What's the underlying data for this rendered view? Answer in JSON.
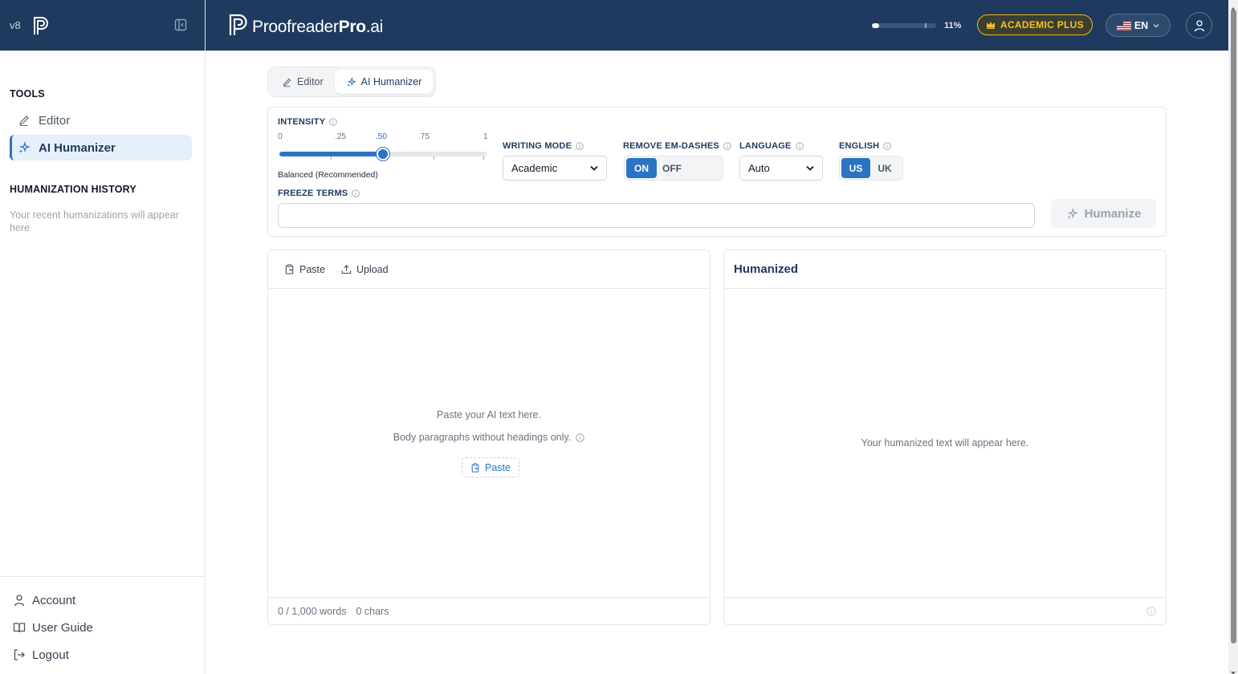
{
  "app": {
    "version": "v8",
    "brand_main": "Proofreader",
    "brand_bold": "Pro",
    "brand_suffix": ".ai",
    "colors": {
      "navy": "#1e3a5f",
      "accent": "#2c73c4",
      "gold": "#f8c029"
    }
  },
  "header": {
    "usage_percent_label": "11%",
    "usage_fraction": 0.11,
    "plan_label": "ACADEMIC PLUS",
    "plan_icon": "crown-icon",
    "language_label": "EN",
    "language_flag": "us-flag-icon",
    "user_icon": "user-icon"
  },
  "sidebar": {
    "tools_title": "TOOLS",
    "tools": [
      {
        "label": "Editor",
        "icon": "pencil-icon",
        "active": false
      },
      {
        "label": "AI Humanizer",
        "icon": "sparkle-icon",
        "active": true
      }
    ],
    "history_title": "HUMANIZATION HISTORY",
    "history_empty": "Your recent humanizations will appear here",
    "bottom": [
      {
        "label": "Account",
        "icon": "user-icon"
      },
      {
        "label": "User Guide",
        "icon": "book-icon"
      },
      {
        "label": "Logout",
        "icon": "logout-icon"
      }
    ]
  },
  "mode_tabs": [
    {
      "label": "Editor",
      "icon": "pencil-icon",
      "active": false
    },
    {
      "label": "AI Humanizer",
      "icon": "sparkle-icon",
      "active": true
    }
  ],
  "settings": {
    "intensity": {
      "label": "INTENSITY",
      "ticks": [
        "0",
        ".25",
        ".50",
        ".75",
        "1"
      ],
      "value": 0.5,
      "description": "Balanced (Recommended)"
    },
    "writing_mode": {
      "label": "WRITING MODE",
      "value": "Academic"
    },
    "remove_em_dashes": {
      "label": "REMOVE EM-DASHES",
      "on_label": "ON",
      "off_label": "OFF",
      "selected": "ON"
    },
    "language": {
      "label": "LANGUAGE",
      "value": "Auto"
    },
    "english": {
      "label": "ENGLISH",
      "us_label": "US",
      "uk_label": "UK",
      "selected": "US"
    },
    "freeze_terms": {
      "label": "FREEZE TERMS",
      "value": "",
      "placeholder": ""
    },
    "humanize_button": "Humanize"
  },
  "input_panel": {
    "paste_label": "Paste",
    "upload_label": "Upload",
    "empty_line1": "Paste your AI text here.",
    "empty_line2": "Body paragraphs without headings only.",
    "empty_paste_label": "Paste",
    "word_count": "0 / 1,000 words",
    "char_count": "0 chars"
  },
  "output_panel": {
    "title": "Humanized",
    "empty": "Your humanized text will appear here."
  }
}
